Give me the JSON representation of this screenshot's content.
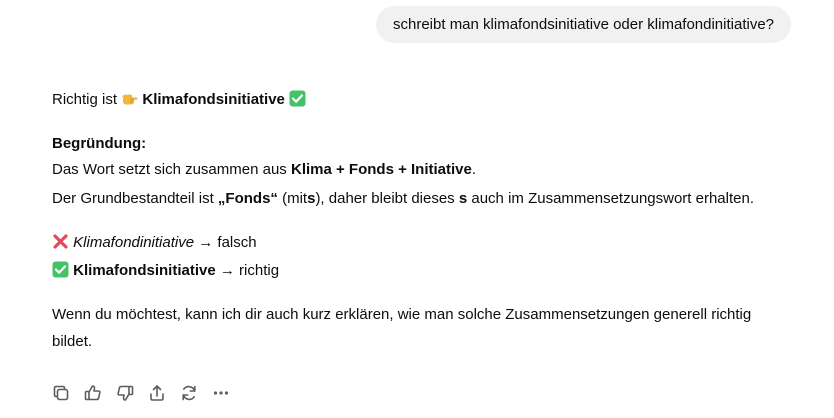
{
  "user_message": {
    "text": "schreibt man klimafondsinitiative oder klimafondinitiative?"
  },
  "answer": {
    "intro_prefix": "Richtig ist",
    "intro_word": "Klimafondsinitiative",
    "reason_heading": "Begründung:",
    "line1_prefix": "Das Wort setzt sich zusammen aus",
    "line1_bold": "Klima + Fonds + Initiative",
    "line1_suffix": ".",
    "line2_prefix": "Der Grundbestandteil ist",
    "line2_bold": "„Fonds“",
    "line2_mid1": "(mit",
    "line2_s1": "s",
    "line2_mid2": "), daher bleibt dieses",
    "line2_s2": "s",
    "line2_suffix": "auch im Zusammensetzungswort erhalten.",
    "wrong_word": "Klimafondinitiative",
    "wrong_suffix": "→ falsch",
    "right_word": "Klimafondsinitiative",
    "right_suffix": "→ richtig",
    "closing_line1": "Wenn du möchtest, kann ich dir auch kurz erklären, wie man solche Zusammensetzungen generell richtig",
    "closing_line2": "bildet."
  },
  "emojis": {
    "pointing": "pointing-hand",
    "check": "check-mark-button",
    "cross": "cross-mark"
  },
  "colors": {
    "bubble_bg": "#f1f1f1",
    "text": "#0d0d0d",
    "icon": "#5d5d5d",
    "check_green": "#44c267",
    "cross_red": "#e8475e",
    "hand_yellow": "#f5b43a"
  },
  "actions": [
    "copy",
    "thumbs-up",
    "thumbs-down",
    "share",
    "regenerate",
    "more"
  ]
}
